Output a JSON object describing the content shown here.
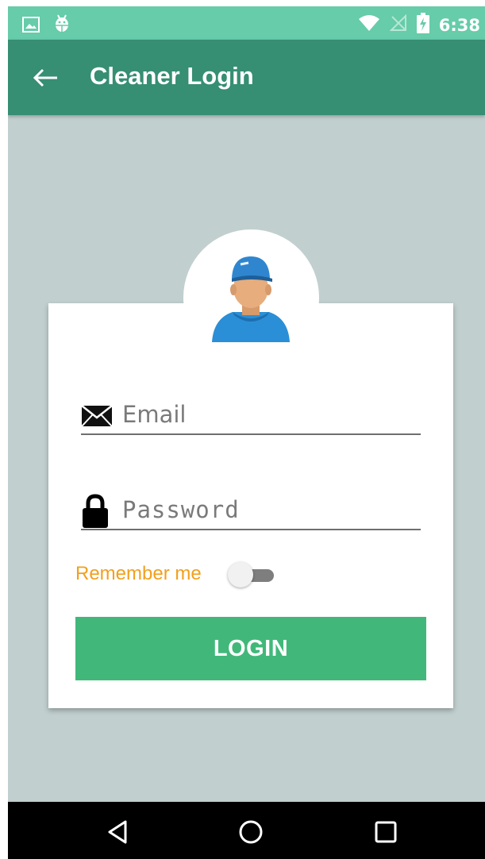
{
  "status_bar": {
    "time": "6:38",
    "left_icons": [
      "image-icon",
      "android-debug-icon"
    ],
    "right_icons": [
      "wifi-icon",
      "no-signal-icon",
      "battery-charging-icon"
    ]
  },
  "app_bar": {
    "back_icon": "arrow-left-icon",
    "title": "Cleaner Login"
  },
  "login_card": {
    "avatar": "cleaner-avatar",
    "email": {
      "placeholder": "Email",
      "value": "",
      "icon": "envelope-icon"
    },
    "password": {
      "placeholder": "Password",
      "value": "",
      "icon": "lock-icon"
    },
    "remember_me": {
      "label": "Remember me",
      "checked": false
    },
    "login_button": "LOGIN"
  },
  "nav_bar": {
    "items": [
      "back-triangle-icon",
      "home-circle-icon",
      "recents-square-icon"
    ]
  },
  "colors": {
    "status_bar": "#66cca9",
    "app_bar": "#368e73",
    "background": "#c1cfcf",
    "accent": "#41b87a",
    "remember_label": "#f2a01e"
  }
}
